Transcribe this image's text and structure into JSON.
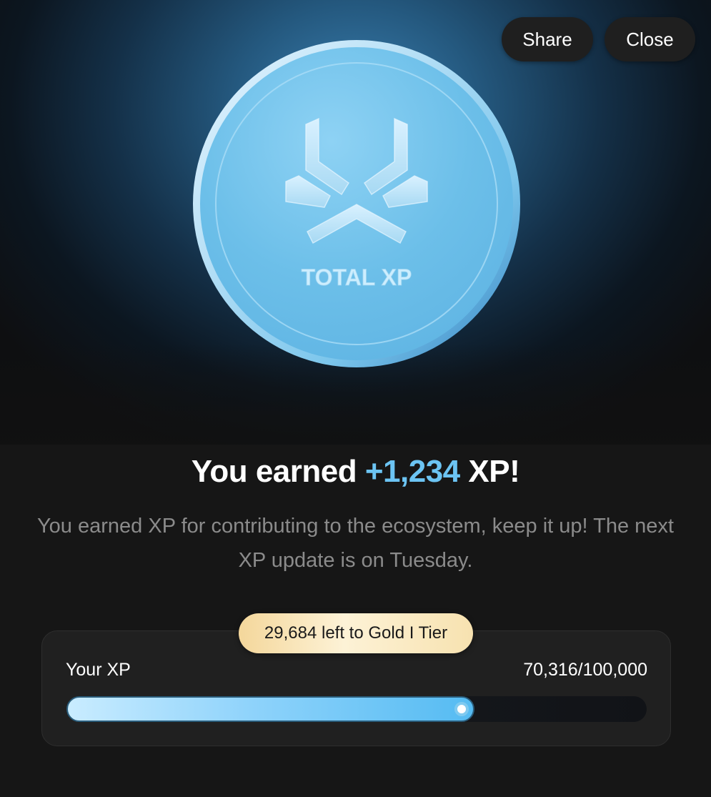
{
  "header": {
    "share_label": "Share",
    "close_label": "Close"
  },
  "coin": {
    "icon": "total-xp-logo-icon",
    "label": "TOTAL XP"
  },
  "headline": {
    "prefix": "You earned ",
    "amount": "+1,234",
    "suffix": " XP!"
  },
  "description": "You earned XP for contributing to the ecosystem, keep it up! The next XP update is on Tuesday.",
  "xp": {
    "tier_message": "29,684 left to Gold I Tier",
    "label": "Your XP",
    "value_text": "70,316/100,000",
    "current": 70316,
    "target": 100000
  },
  "colors": {
    "accent": "#6cc4f3",
    "gold": "#f4d79b",
    "background": "#161616"
  }
}
